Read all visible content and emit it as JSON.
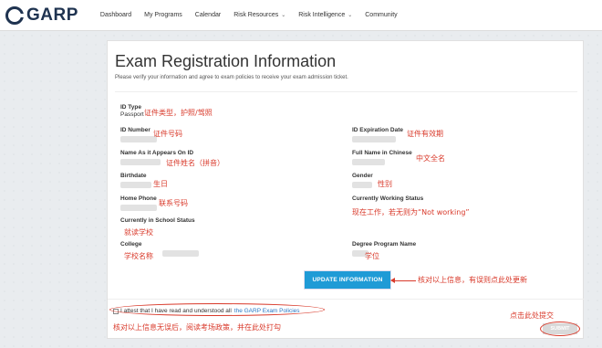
{
  "nav": {
    "logo": "GARP",
    "items": [
      {
        "label": "Dashboard"
      },
      {
        "label": "My Programs"
      },
      {
        "label": "Calendar"
      },
      {
        "label": "Risk Resources",
        "caret": "⌄"
      },
      {
        "label": "Risk Intelligence",
        "caret": "⌄"
      },
      {
        "label": "Community"
      }
    ]
  },
  "page": {
    "title": "Exam Registration Information",
    "subtitle": "Please verify your information and agree to exam policies to receive your exam admission ticket."
  },
  "fields": {
    "id_type": {
      "label": "ID Type",
      "value": "Passport",
      "note": "证件类型，护照/驾照"
    },
    "id_number": {
      "label": "ID Number",
      "note": "证件号码"
    },
    "id_expiration": {
      "label": "ID Expiration Date",
      "note": "证件有效期"
    },
    "name_on_id": {
      "label": "Name As it Appears On ID",
      "note": "证件姓名（拼音）"
    },
    "full_name_chinese": {
      "label": "Full Name in Chinese",
      "note": "中文全名"
    },
    "birthdate": {
      "label": "Birthdate",
      "note": "生日"
    },
    "gender": {
      "label": "Gender",
      "note": "性别"
    },
    "home_phone": {
      "label": "Home Phone",
      "note": "联系号码"
    },
    "working_status": {
      "label": "Currently Working Status",
      "note": "现在工作，若无则为“Not working”"
    },
    "school_status": {
      "label": "Currently in School Status",
      "note": "就读学校"
    },
    "college": {
      "label": "College",
      "note": "学校名称"
    },
    "degree_program": {
      "label": "Degree Program Name",
      "note": "学位"
    }
  },
  "update": {
    "button_label": "UPDATE INFORMATION",
    "note": "核对以上信息，有误则点此处更新"
  },
  "attest": {
    "text": "I attest that I have read and understood all",
    "link": "the GARP Exam Policies",
    "note": "核对以上信息无误后，阅读考场政策，并在此处打勾"
  },
  "submit": {
    "button_label": "SUBMIT",
    "note": "点击此处提交"
  },
  "colors": {
    "accent": "#1f9bd6",
    "annotation": "#d93a2b",
    "brand": "#1f3350"
  }
}
